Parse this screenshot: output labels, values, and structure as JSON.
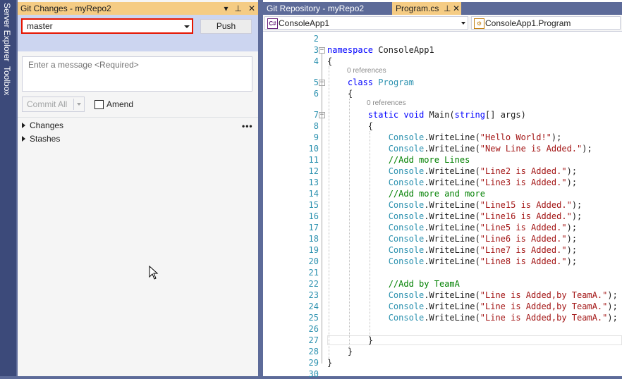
{
  "side_tabs": [
    "Server Explorer",
    "Toolbox"
  ],
  "git_panel": {
    "title": "Git Changes - myRepo2",
    "branch": "master",
    "push_label": "Push",
    "message_placeholder": "Enter a message <Required>",
    "commit_label": "Commit All",
    "amend_label": "Amend",
    "changes_label": "Changes",
    "stashes_label": "Stashes",
    "more_label": "•••"
  },
  "editor": {
    "tabs": [
      "Git Repository - myRepo2",
      "Program.cs"
    ],
    "nav_project": "ConsoleApp1",
    "nav_class": "ConsoleApp1.Program",
    "nav_icon": "C#",
    "references": "0 references",
    "lines": [
      {
        "n": "2",
        "t": ""
      },
      {
        "n": "3",
        "t": "namespace ConsoleApp1"
      },
      {
        "n": "4",
        "t": "{"
      },
      {
        "n": "5",
        "t": "    class Program"
      },
      {
        "n": "6",
        "t": "    {"
      },
      {
        "n": "7",
        "t": "        static void Main(string[] args)"
      },
      {
        "n": "8",
        "t": "        {"
      },
      {
        "n": "9",
        "t": "            Console.WriteLine(\"Hello World!\");"
      },
      {
        "n": "10",
        "t": "            Console.WriteLine(\"New Line is Added.\");"
      },
      {
        "n": "11",
        "t": "            //Add more Lines"
      },
      {
        "n": "12",
        "t": "            Console.WriteLine(\"Line2 is Added.\");"
      },
      {
        "n": "13",
        "t": "            Console.WriteLine(\"Line3 is Added.\");"
      },
      {
        "n": "14",
        "t": "            //Add more and more"
      },
      {
        "n": "15",
        "t": "            Console.WriteLine(\"Line15 is Added.\");"
      },
      {
        "n": "16",
        "t": "            Console.WriteLine(\"Line16 is Added.\");"
      },
      {
        "n": "17",
        "t": "            Console.WriteLine(\"Line5 is Added.\");"
      },
      {
        "n": "18",
        "t": "            Console.WriteLine(\"Line6 is Added.\");"
      },
      {
        "n": "19",
        "t": "            Console.WriteLine(\"Line7 is Added.\");"
      },
      {
        "n": "20",
        "t": "            Console.WriteLine(\"Line8 is Added.\");"
      },
      {
        "n": "21",
        "t": ""
      },
      {
        "n": "22",
        "t": "            //Add by TeamA"
      },
      {
        "n": "23",
        "t": "            Console.WriteLine(\"Line is Added,by TeamA.\");"
      },
      {
        "n": "24",
        "t": "            Console.WriteLine(\"Line is Added,by TeamA.\");"
      },
      {
        "n": "25",
        "t": "            Console.WriteLine(\"Line is Added,by TeamA.\");"
      },
      {
        "n": "26",
        "t": ""
      },
      {
        "n": "27",
        "t": "        }"
      },
      {
        "n": "28",
        "t": "    }"
      },
      {
        "n": "29",
        "t": "}"
      },
      {
        "n": "30",
        "t": ""
      }
    ]
  }
}
